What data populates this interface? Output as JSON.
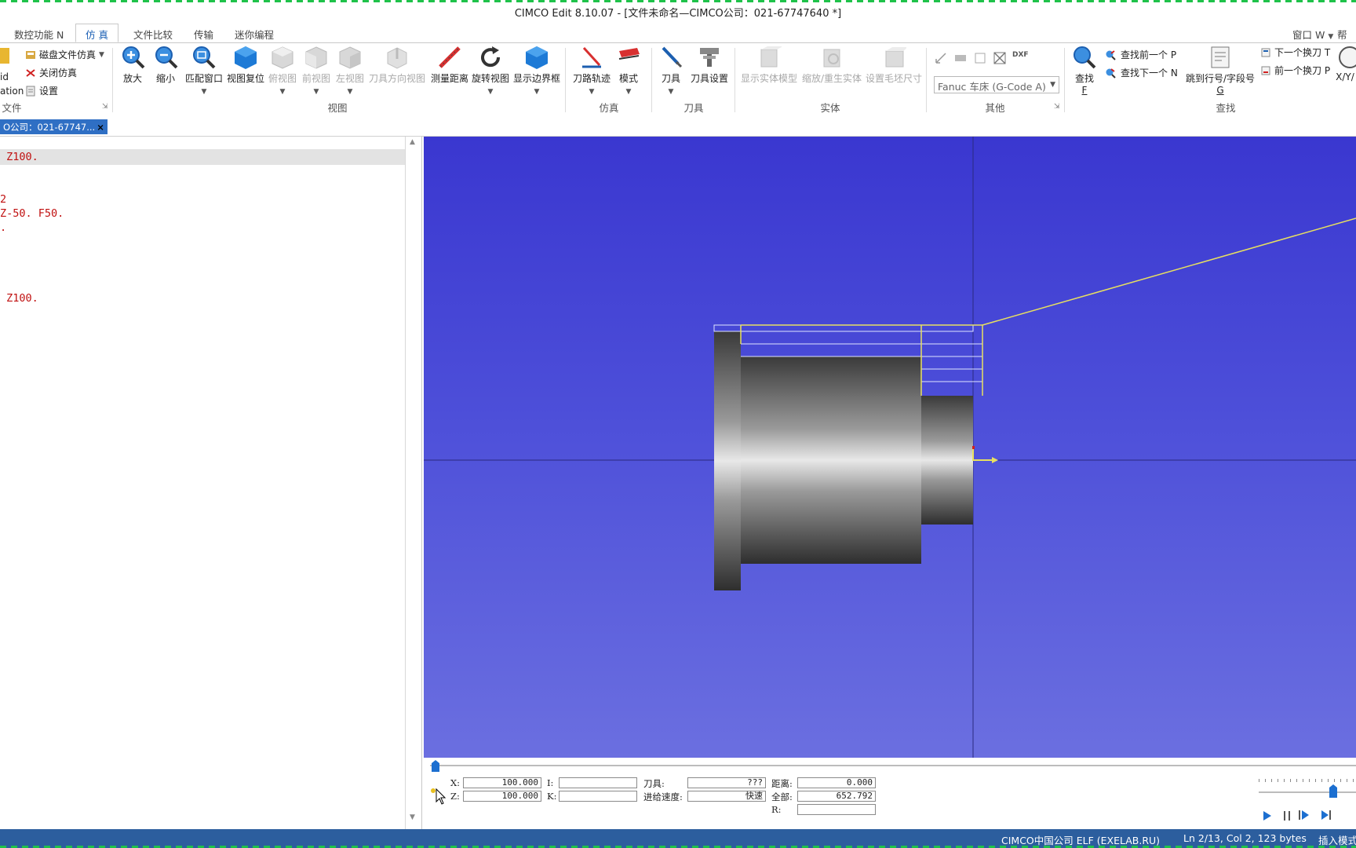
{
  "window": {
    "title": "CIMCO Edit 8.10.07 - [文件未命名—CIMCO公司：021-67747640 *]"
  },
  "ribbon_tabs": [
    {
      "label": "数控功能 N"
    },
    {
      "label": "仿 真"
    },
    {
      "label": "文件比较"
    },
    {
      "label": "传输"
    },
    {
      "label": "迷你编程"
    }
  ],
  "ribbon_right": {
    "window_menu": "窗口 W",
    "help_menu": "帮助"
  },
  "file_group": {
    "left_partial_1": "id",
    "left_partial_2": "ation",
    "disk_sim": "磁盘文件仿真",
    "close_sim": "关闭仿真",
    "settings": "设置",
    "label": "文件"
  },
  "view_group": {
    "buttons": [
      "放大",
      "缩小",
      "匹配窗口",
      "视图复位",
      "俯视图",
      "前视图",
      "左视图",
      "刀具方向视图",
      "测量距离",
      "旋转视图",
      "显示边界框"
    ],
    "label": "视图"
  },
  "sim_group": {
    "buttons": [
      "刀路轨迹",
      "模式"
    ],
    "label": "仿真"
  },
  "tool_group": {
    "buttons": [
      "刀具",
      "刀具设置"
    ],
    "label": "刀具"
  },
  "solid_group": {
    "buttons": [
      "显示实体模型",
      "缩放/重生实体",
      "设置毛坯尺寸"
    ],
    "label": "实体"
  },
  "other_group": {
    "machine": "Fanuc 车床 (G-Code A)",
    "label": "其他",
    "dxf": "DXF"
  },
  "find_group": {
    "find": "查找",
    "find_key": "F",
    "find_prev": "查找前一个 P",
    "find_next": "查找下一个 N",
    "goto": "跳到行号/字段号",
    "goto_key": "G",
    "next_tool": "下一个换刀 T",
    "prev_tool": "前一个换刀 P",
    "xyz": "X/Y/",
    "label": "查找"
  },
  "doc_tab": {
    "label": "O公司：021-67747..."
  },
  "editor": {
    "lines": [
      {
        "text": " Z100."
      },
      {
        "text": ""
      },
      {
        "text": ""
      },
      {
        "text": "2"
      },
      {
        "text": "Z-50. F50."
      },
      {
        "text": "."
      },
      {
        "text": ""
      },
      {
        "text": ""
      },
      {
        "text": ""
      },
      {
        "text": ""
      },
      {
        "text": " Z100."
      }
    ]
  },
  "readout": {
    "x_label": "X:",
    "x_value": "100.000",
    "z_label": "Z:",
    "z_value": "100.000",
    "i_label": "I:",
    "i_value": "",
    "k_label": "K:",
    "k_value": "",
    "tool_label": "刀具:",
    "tool_value": "???",
    "feed_label": "进给速度:",
    "feed_value": "快速",
    "dist_label": "距离:",
    "dist_value": "0.000",
    "total_label": "全部:",
    "total_value": "652.792",
    "r_label": "R:",
    "r_value": ""
  },
  "statusbar": {
    "company": "CIMCO中国公司 ELF (EXELAB.RU)",
    "position": "Ln 2/13, Col 2, 123 bytes",
    "mode": "插入模式"
  },
  "colors": {
    "accent": "#2f6fc4",
    "viewport_top": "#3a37d0",
    "viewport_bottom": "#6b6fe0",
    "toolpath": "#e8e060",
    "code": "#c01010",
    "statusbar": "#2c5e9e"
  }
}
